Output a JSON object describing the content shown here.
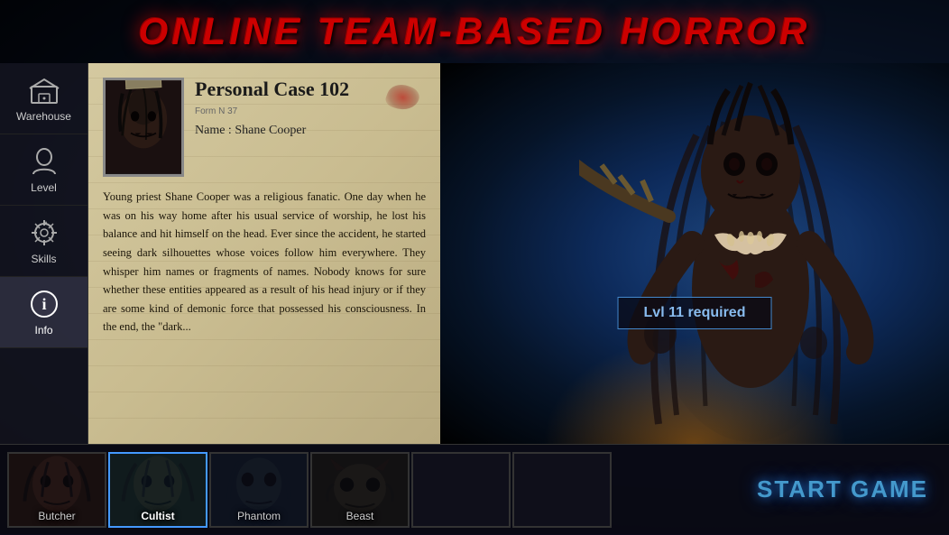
{
  "header": {
    "title": "ONLINE TEAM-BASED HORROR"
  },
  "sidebar": {
    "items": [
      {
        "id": "warehouse",
        "label": "Warehouse",
        "icon": "🎒",
        "active": false
      },
      {
        "id": "level",
        "label": "Level",
        "icon": "👤",
        "active": false
      },
      {
        "id": "skills",
        "label": "Skills",
        "icon": "⚙",
        "active": false
      },
      {
        "id": "info",
        "label": "Info",
        "icon": "ℹ",
        "active": true
      }
    ]
  },
  "case_file": {
    "title": "Personal Case 102",
    "form_number": "Form N 37",
    "name_label": "Name : Shane Cooper",
    "description": "Young priest Shane Cooper was a religious fanatic. One day when he was on his way home after his usual service of worship, he lost his balance and hit himself on the head. Ever since the accident, he started seeing dark silhouettes whose voices follow him everywhere. They whisper him names or fragments of names. Nobody knows for sure whether these entities appeared as a result of his head injury or if they are some kind of demonic force that possessed his consciousness. In the end, the \"dark..."
  },
  "character": {
    "level_required": "Lvl 11 required"
  },
  "bottom_bar": {
    "characters": [
      {
        "id": "butcher",
        "label": "Butcher",
        "active": false
      },
      {
        "id": "cultist",
        "label": "Cultist",
        "active": true
      },
      {
        "id": "phantom",
        "label": "Phantom",
        "active": false
      },
      {
        "id": "beast",
        "label": "Beast",
        "active": false
      },
      {
        "id": "char5",
        "label": "",
        "active": false
      },
      {
        "id": "char6",
        "label": "",
        "active": false
      }
    ],
    "start_button": "START GAME"
  },
  "colors": {
    "accent_red": "#cc0000",
    "accent_blue": "#4499cc",
    "sidebar_bg": "rgba(20,20,30,0.85)",
    "case_bg": "#c9bc90"
  }
}
